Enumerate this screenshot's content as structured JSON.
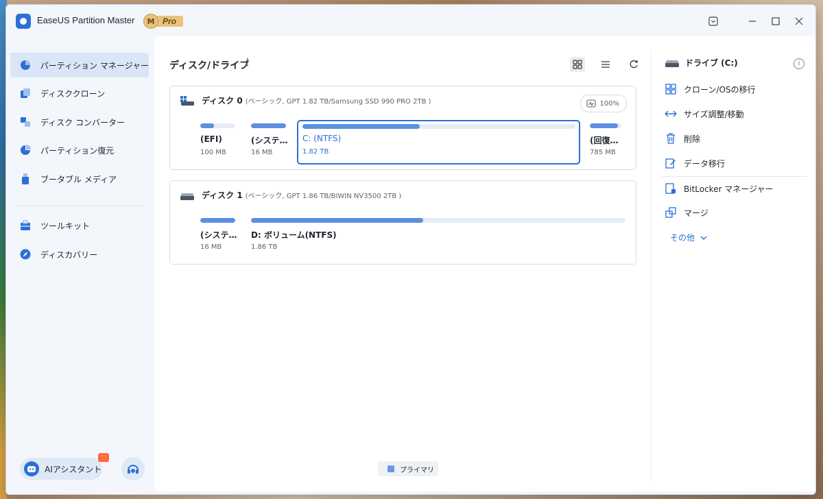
{
  "app": {
    "title": "EaseUS Partition Master",
    "badge_letter": "M",
    "badge_text": "Pro"
  },
  "sidebar": {
    "items": [
      {
        "label": "パーティション マネージャー",
        "active": true
      },
      {
        "label": "ディスククローン"
      },
      {
        "label": "ディスク コンバーター"
      },
      {
        "label": "パーティション復元"
      },
      {
        "label": "ブータブル メディア"
      },
      {
        "label": "ツールキット"
      },
      {
        "label": "ディスカバリー"
      }
    ],
    "ai_assistant": "AIアシスタント",
    "ai_bubble": "···"
  },
  "main": {
    "title": "ディスク/ドライブ",
    "more_glyph": "⋮",
    "disks": [
      {
        "name": "ディスク 0",
        "info": "(ベーシック, GPT 1.82 TB/Samsung SSD 990 PRO 2TB )",
        "health": "100%",
        "partitions": [
          {
            "name": "(EFI)",
            "size": "100 MB",
            "used": 0.4
          },
          {
            "name": "(システ…",
            "size": "16 MB",
            "used": 1.0
          },
          {
            "name": "C: (NTFS)",
            "size": "1.82 TB",
            "used": 0.43,
            "selected": true
          },
          {
            "name": "(回復…",
            "size": "785 MB",
            "used": 0.9
          }
        ]
      },
      {
        "name": "ディスク 1",
        "info": "(ベーシック, GPT 1.86 TB/BIWIN NV3500 2TB )",
        "partitions": [
          {
            "name": "(システ…",
            "size": "16 MB",
            "used": 1.0
          },
          {
            "name": "D: ボリューム(NTFS)",
            "size": "1.86 TB",
            "used": 0.46
          }
        ]
      }
    ],
    "legend": "プライマリ"
  },
  "right_panel": {
    "header": "ドライブ (C:)",
    "info_glyph": "i",
    "actions": [
      "クローン/OSの移行",
      "サイズ調整/移動",
      "削除",
      "データ移行",
      "BitLocker マネージャー",
      "マージ"
    ],
    "more": "その他"
  },
  "colors": {
    "accent": "#2d6fd6",
    "bar_fill": "#5c8fdf",
    "bar_track": "#e6ecf5",
    "active_bg": "#d9e6f7"
  }
}
